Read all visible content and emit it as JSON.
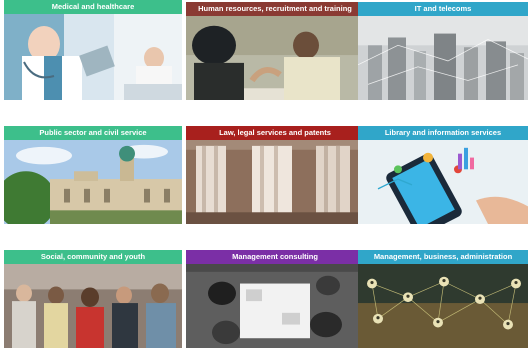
{
  "tiles": [
    {
      "label": "Medical and healthcare",
      "bar_color": "#3dbf8b",
      "scene": "hospital-photo"
    },
    {
      "label": "Human resources, recruitment and training",
      "bar_color": "#8a3a33",
      "scene": "meeting-photo"
    },
    {
      "label": "IT and telecoms",
      "bar_color": "#30a6c9",
      "scene": "city-network-photo"
    },
    {
      "label": "Public sector and civil service",
      "bar_color": "#3dbf8b",
      "scene": "city-hall-photo"
    },
    {
      "label": "Law, legal services and patents",
      "bar_color": "#a8201d",
      "scene": "columns-photo"
    },
    {
      "label": "Library and information services",
      "bar_color": "#30a6c9",
      "scene": "phone-data-photo"
    },
    {
      "label": "Social, community and youth",
      "bar_color": "#3dbf8b",
      "scene": "group-photo"
    },
    {
      "label": "Management consulting",
      "bar_color": "#7b2fa6",
      "scene": "office-table-photo"
    },
    {
      "label": "Management, business, administration",
      "bar_color": "#30a6c9",
      "scene": "people-network-photo"
    }
  ]
}
